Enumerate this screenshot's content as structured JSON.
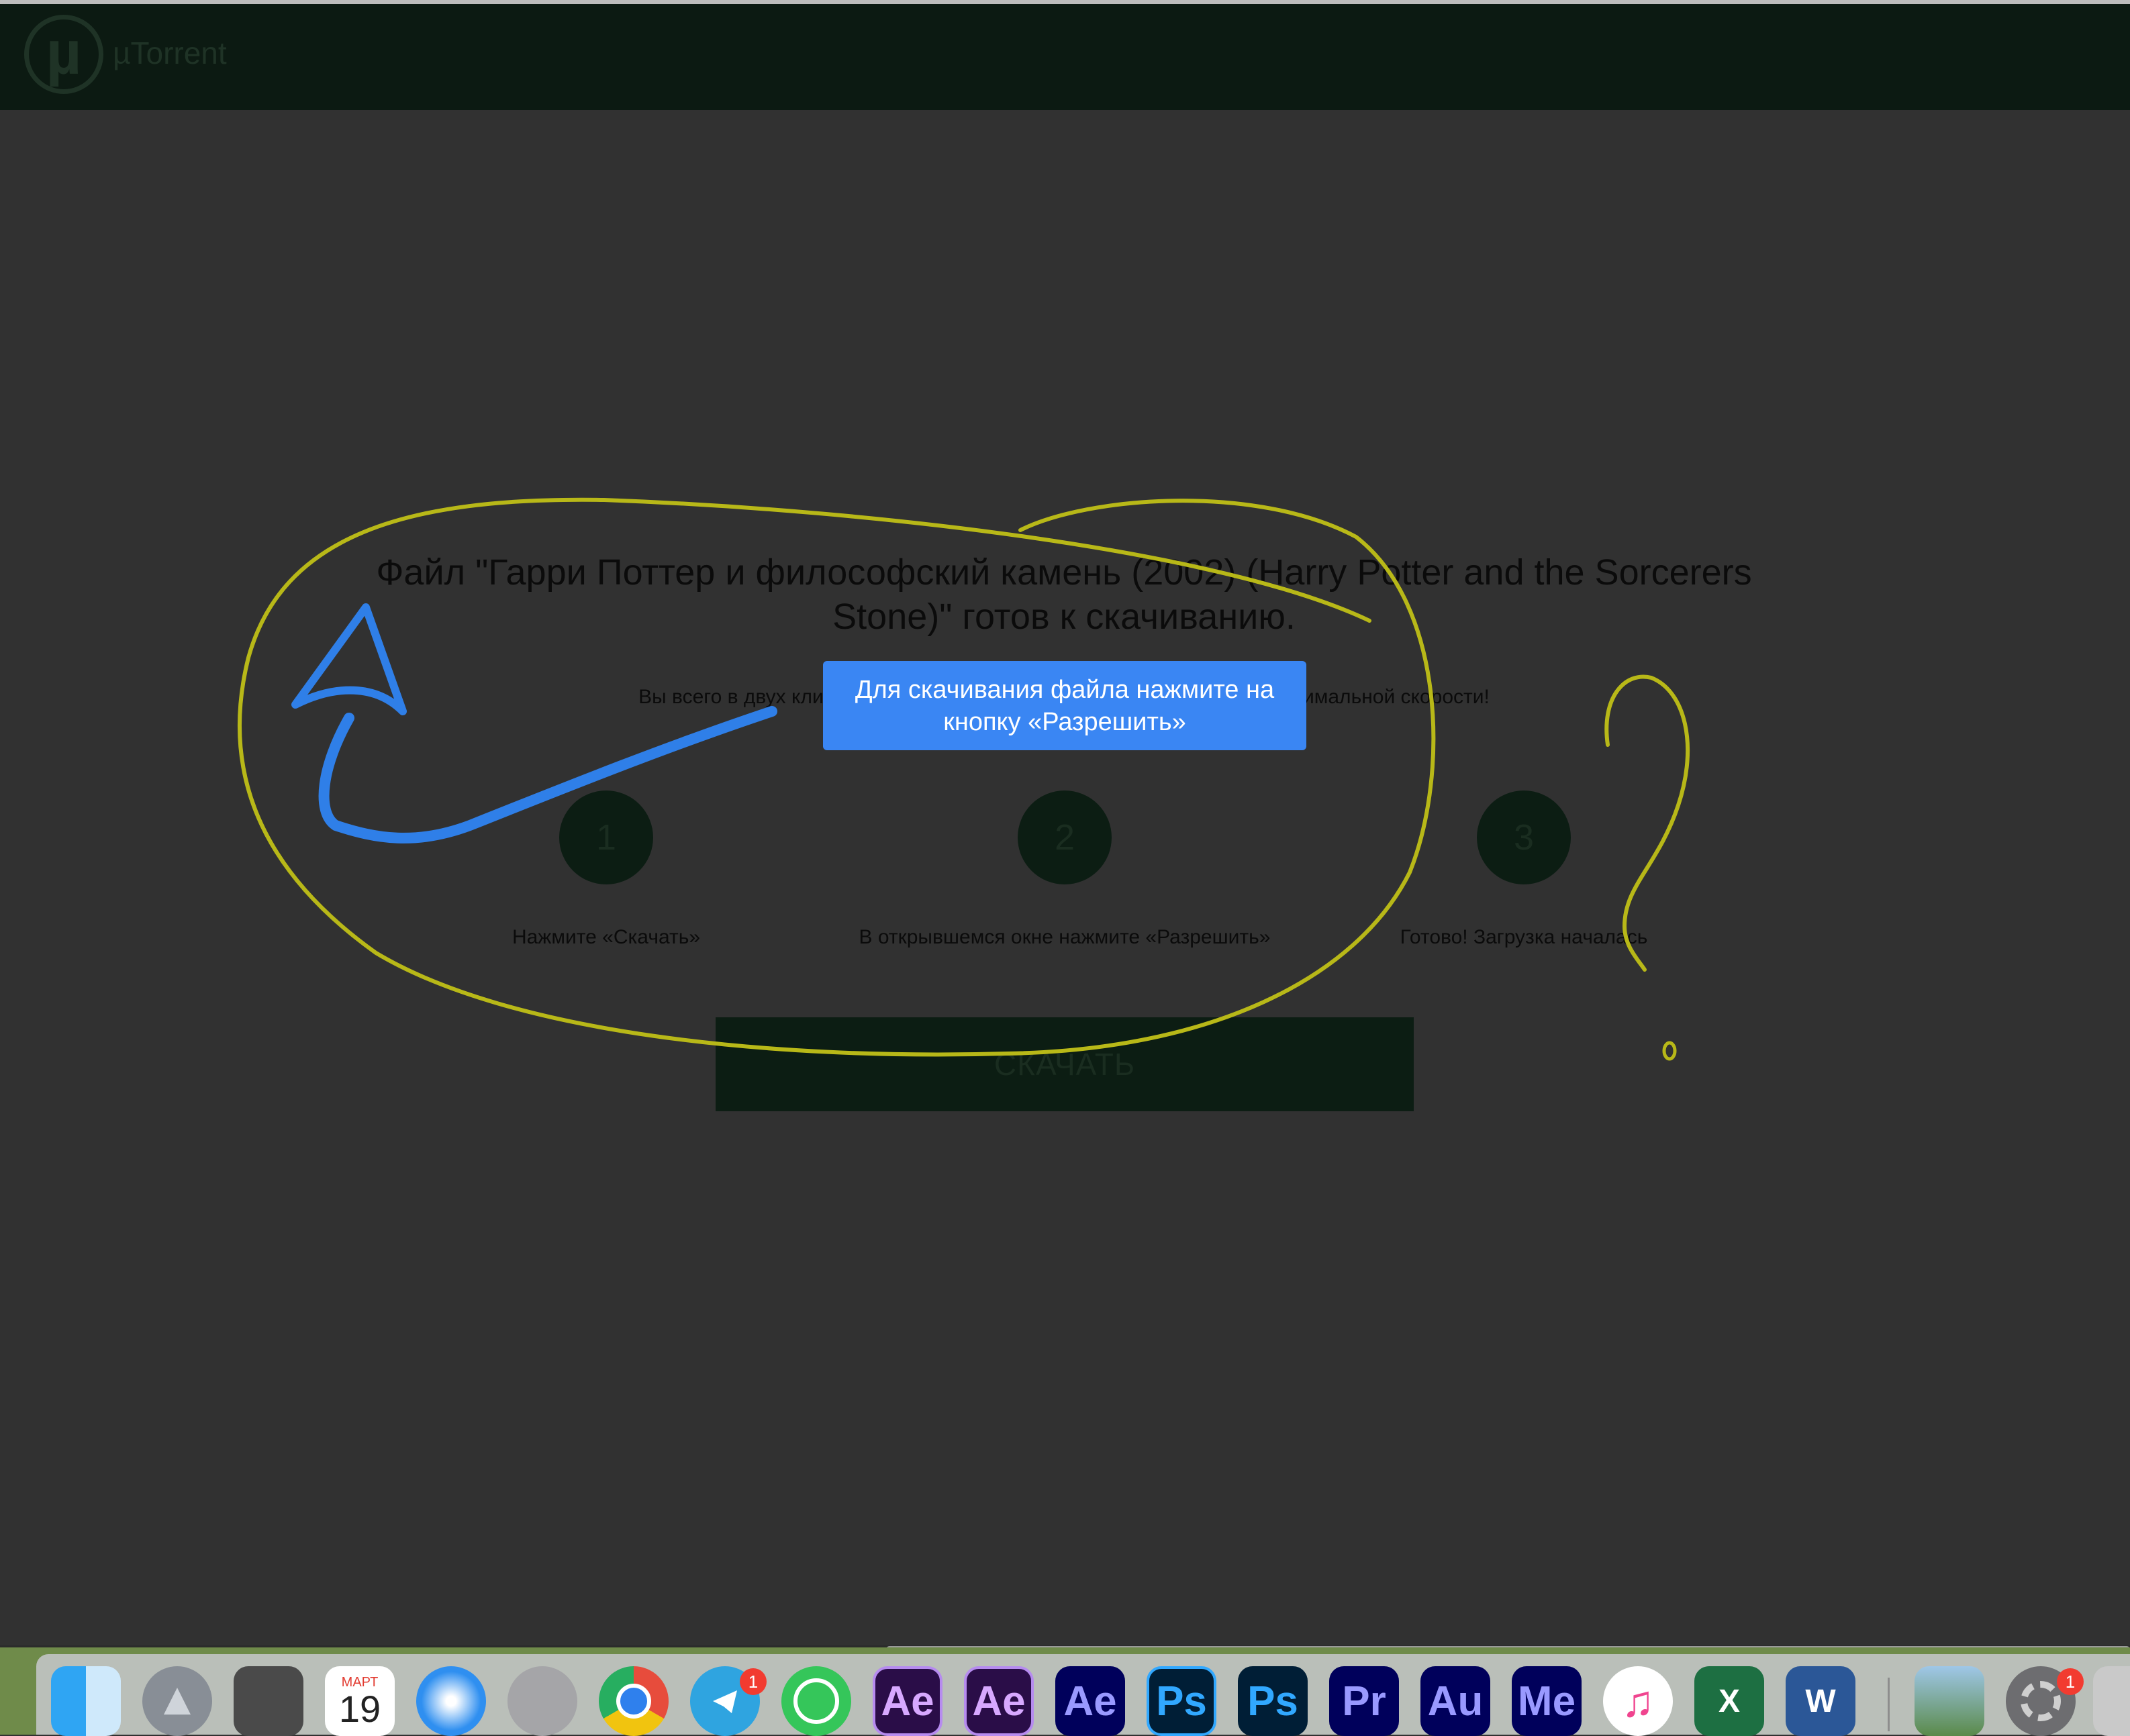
{
  "app": {
    "logo_text": "µTorrent",
    "logo_symbol": "µ"
  },
  "main": {
    "title": "Файл \"Гарри Поттер и философский камень (2002) (Harry Potter and the Sorcerers Stone)\" готов к скачиванию.",
    "subtitle": "Вы всего в двух кликах до нужного файла — скачайте торрент на максимальной скорости!",
    "tooltip": "Для скачивания файла нажмите на кнопку «Разрешить»",
    "steps": [
      {
        "number": "1",
        "label": "Нажмите «Скачать»"
      },
      {
        "number": "2",
        "label": "В открывшемся окне нажмите «Разрешить»"
      },
      {
        "number": "3",
        "label": "Готово! Загрузка началась"
      }
    ],
    "download_label": "СКАЧАТЬ"
  },
  "dock": {
    "calendar_month": "МАРТ",
    "calendar_day": "19",
    "ae1": "Ae",
    "ae2": "Ae",
    "ae3": "Ae",
    "ps1": "Ps",
    "ps2": "Ps",
    "pr": "Pr",
    "au": "Au",
    "me": "Me",
    "excel": "X",
    "word": "W",
    "telegram_badge": "1",
    "prefs_badge": "1"
  },
  "colors": {
    "accent": "#3a86f3",
    "header": "#0c1a12",
    "annotation_yellow": "#b8b818",
    "annotation_blue": "#2f7fe8"
  },
  "icons": [
    "finder-icon",
    "launchpad-icon",
    "calculator-icon",
    "calendar-icon",
    "safari-icon",
    "quicktime-icon",
    "chrome-icon",
    "telegram-icon",
    "whatsapp-icon",
    "after-effects-icon",
    "photoshop-icon",
    "premiere-icon",
    "audition-icon",
    "media-encoder-icon",
    "itunes-icon",
    "excel-icon",
    "word-icon",
    "preview-icon",
    "system-preferences-icon"
  ]
}
